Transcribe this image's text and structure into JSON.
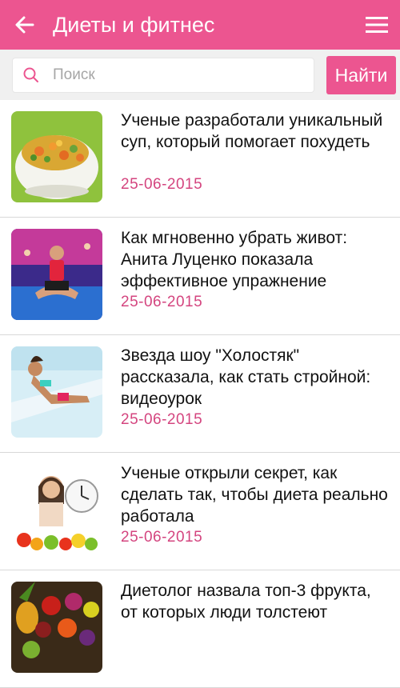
{
  "app_bar": {
    "title": "Диеты и фитнес",
    "back_icon": "arrow-left-icon",
    "menu_icon": "hamburger-menu-icon",
    "color": "#ec5590"
  },
  "search": {
    "placeholder": "Поиск",
    "value": "",
    "icon": "search-icon",
    "button_label": "Найти"
  },
  "articles": [
    {
      "title": "Ученые разработали уникальный суп, который помогает похудеть",
      "date": "25-06-2015",
      "image": "vegetable-soup-image"
    },
    {
      "title": "Как мгновенно убрать живот: Анита Луценко показала эффективное упражнение",
      "date": "25-06-2015",
      "image": "fitness-trainer-image"
    },
    {
      "title": "Звезда шоу \"Холостяк\" рассказала, как стать стройной: видеоурок",
      "date": "25-06-2015",
      "image": "woman-on-sunbed-image"
    },
    {
      "title": "Ученые открыли секрет, как сделать так, чтобы диета реально работала",
      "date": "25-06-2015",
      "image": "woman-clock-fruits-image"
    },
    {
      "title": "Диетолог назвала топ-3 фрукта, от которых люди толстеют",
      "date": "",
      "image": "fruits-image"
    }
  ],
  "colors": {
    "accent": "#ec5590",
    "date": "#d4457f",
    "divider": "#d8d8d8"
  }
}
